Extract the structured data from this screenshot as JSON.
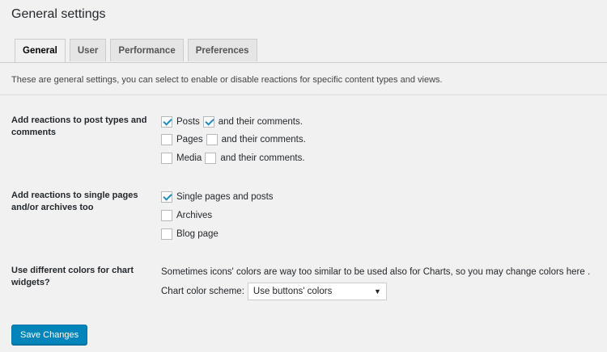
{
  "page": {
    "title": "General settings"
  },
  "tabs": [
    {
      "label": "General"
    },
    {
      "label": "User"
    },
    {
      "label": "Performance"
    },
    {
      "label": "Preferences"
    }
  ],
  "description": "These are general settings, you can select to enable or disable reactions for specific content types and views.",
  "sections": {
    "post_types": {
      "label": "Add reactions to post types and comments",
      "options": [
        {
          "label": "Posts",
          "checked": true,
          "comments_label": "and their comments.",
          "comments_checked": true
        },
        {
          "label": "Pages",
          "checked": false,
          "comments_label": "and their comments.",
          "comments_checked": false
        },
        {
          "label": "Media",
          "checked": false,
          "comments_label": "and their comments.",
          "comments_checked": false
        }
      ]
    },
    "single_pages": {
      "label": "Add reactions to single pages and/or archives too",
      "options": [
        {
          "label": "Single pages and posts",
          "checked": true
        },
        {
          "label": "Archives",
          "checked": false
        },
        {
          "label": "Blog page",
          "checked": false
        }
      ]
    },
    "chart_colors": {
      "label": "Use different colors for chart widgets?",
      "note": "Sometimes icons' colors are way too similar to be used also for Charts, so you may change colors here .",
      "scheme_label": "Chart color scheme:",
      "scheme_value": "Use buttons' colors"
    }
  },
  "save_button": "Save Changes",
  "colors": {
    "accent": "#0085ba",
    "checkmark": "#1e8cbe",
    "background": "#f1f1f1"
  }
}
